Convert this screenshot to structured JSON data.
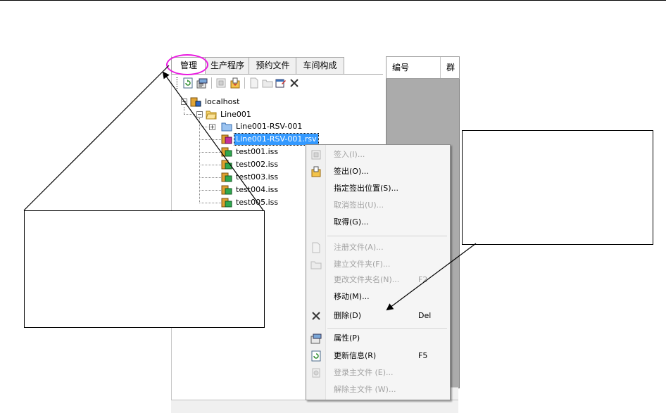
{
  "tabs": [
    "管理",
    "生产程序",
    "预约文件",
    "车间构成"
  ],
  "toolbar_icons": [
    "refresh-icon",
    "properties-icon",
    "checkin-icon",
    "checkout-icon",
    "register-file-icon",
    "new-folder-icon",
    "rename-icon",
    "delete-icon"
  ],
  "tree": {
    "root": "localhost",
    "line": "Line001",
    "folder": "Line001-RSV-001",
    "selected": "Line001-RSV-001.rsv",
    "files": [
      "test001.iss",
      "test002.iss",
      "test003.iss",
      "test004.iss",
      "test005.iss"
    ]
  },
  "grid": {
    "columns": [
      "编号",
      "群"
    ]
  },
  "menu": {
    "items": [
      {
        "label": "签入(I)...",
        "key": "",
        "disabled": true,
        "icon": "checkin-icon"
      },
      {
        "label": "签出(O)...",
        "key": "",
        "disabled": false,
        "icon": "checkout-icon"
      },
      {
        "label": "指定签出位置(S)...",
        "key": "",
        "disabled": false,
        "icon": ""
      },
      {
        "label": "取消签出(U)...",
        "key": "",
        "disabled": true,
        "icon": ""
      },
      {
        "label": "取得(G)...",
        "key": "",
        "disabled": false,
        "icon": ""
      },
      {
        "label": "注册文件(A)...",
        "key": "",
        "disabled": true,
        "icon": "register-file-icon"
      },
      {
        "label": "建立文件夹(F)...",
        "key": "",
        "disabled": true,
        "icon": "new-folder-icon"
      },
      {
        "label": "更改文件夹名(N)...",
        "key": "F2",
        "disabled": true,
        "icon": ""
      },
      {
        "label": "移动(M)...",
        "key": "",
        "disabled": false,
        "icon": ""
      },
      {
        "label": "删除(D)",
        "key": "Del",
        "disabled": false,
        "icon": "delete-icon"
      },
      {
        "label": "属性(P)",
        "key": "",
        "disabled": false,
        "icon": "properties-icon"
      },
      {
        "label": "更新信息(R)",
        "key": "F5",
        "disabled": false,
        "icon": "refresh-icon"
      },
      {
        "label": "登录主文件 (E)...",
        "key": "",
        "disabled": true,
        "icon": "master-file-icon"
      },
      {
        "label": "解除主文件 (W)...",
        "key": "",
        "disabled": true,
        "icon": ""
      }
    ]
  },
  "colors": {
    "highlight_circle": "#e91ae0",
    "selection": "#3399ff"
  }
}
